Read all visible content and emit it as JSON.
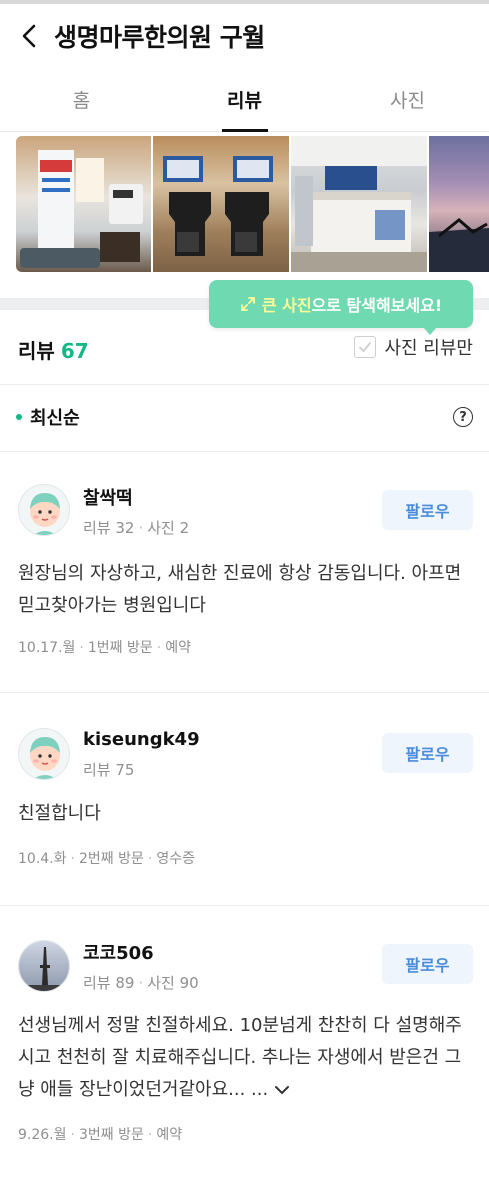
{
  "header": {
    "title": "생명마루한의원 구월"
  },
  "tabs": [
    {
      "label": "홈"
    },
    {
      "label": "리뷰",
      "active": true
    },
    {
      "label": "사진"
    }
  ],
  "tooltip": {
    "highlight": "큰 사진",
    "rest": "으로 탐색해보세요!"
  },
  "reviews_section": {
    "label": "리뷰",
    "count": "67",
    "photo_only_label": "사진 리뷰만"
  },
  "sort": {
    "label": "최신순"
  },
  "help": {
    "label": "?"
  },
  "follow_label": "팔로우",
  "reviews": [
    {
      "user": "찰싹떡",
      "stats": [
        "리뷰 32",
        "사진 2"
      ],
      "body": "원장님의 자상하고, 새심한 진료에 항상 감동입니다. 아프면 믿고찾아가는 병원입니다",
      "meta": [
        "10.17.월",
        "1번째 방문",
        "예약"
      ],
      "avatar": "character-avatar"
    },
    {
      "user": "kiseungk49",
      "stats": [
        "리뷰 75"
      ],
      "body": "친절합니다",
      "meta": [
        "10.4.화",
        "2번째 방문",
        "영수증"
      ],
      "avatar": "character-avatar"
    },
    {
      "user": "코코506",
      "stats": [
        "리뷰 89",
        "사진 90"
      ],
      "body": "선생님께서 정말 친절하세요. 10분넘게 찬찬히 다 설명해주시고 천천히 잘 치료해주십니다. 추나는 자생에서 받은건 그냥 애들 장난이었던거같아요... ...",
      "meta": [
        "9.26.월",
        "3번째 방문",
        "예약"
      ],
      "avatar": "tower-photo-avatar"
    }
  ],
  "colors": {
    "accent": "#12b886",
    "tooltip": "#6fd9b1",
    "follow_text": "#4a8cd9"
  }
}
